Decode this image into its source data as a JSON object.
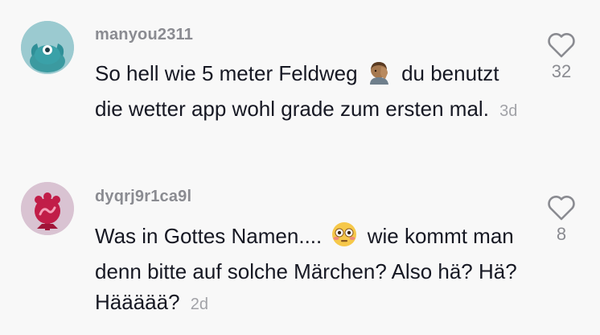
{
  "comments": [
    {
      "username": "manyou2311",
      "text_before_emoji": "So hell wie 5 meter Feldweg",
      "emoji": "facepalm-emoji",
      "text_after_emoji": "du benutzt die wetter app wohl grade zum ersten mal.",
      "age": "3d",
      "likes": "32"
    },
    {
      "username": "dyqrj9r1ca9l",
      "text_before_emoji": "Was in Gottes Namen....",
      "emoji": "flushed-face-emoji",
      "text_after_emoji": "wie kommt man denn bitte auf solche Märchen? Also hä? Hä? Häääää?",
      "age": "2d",
      "likes": "8"
    }
  ],
  "colors": {
    "background": "#f8f8f8",
    "username": "#8a8b91",
    "text": "#161823",
    "age": "#a1a2a7",
    "avatar1_bg": "#9bcad0",
    "avatar2_bg": "#d9c3d2"
  }
}
